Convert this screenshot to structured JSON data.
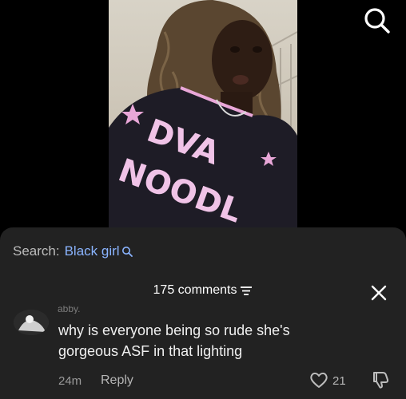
{
  "search_bar": {
    "prefix": "Search:",
    "term": "Black girl"
  },
  "comments": {
    "count_label": "175 comments"
  },
  "comment": {
    "username": "abby.",
    "text": "why is everyone being so rude she's gorgeous ASF in that lighting",
    "time": "24m",
    "reply_label": "Reply",
    "likes": "21"
  },
  "video": {
    "shirt_text_line1": "DVA",
    "shirt_text_line2": "NOODL"
  },
  "colors": {
    "accent": "#8ab4ff",
    "sheet_bg": "#222222"
  },
  "icons": [
    "search-icon",
    "sort-icon",
    "close-icon",
    "heart-icon",
    "dislike-icon"
  ]
}
